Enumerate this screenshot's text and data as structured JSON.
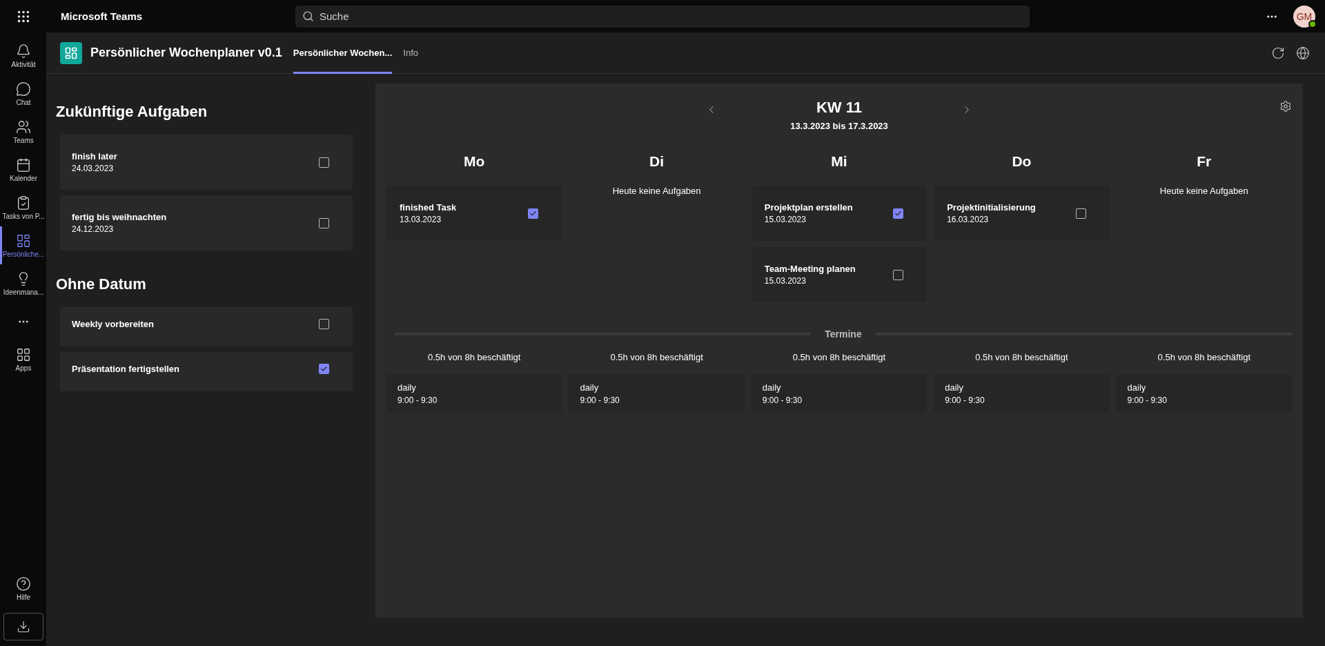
{
  "top_bar": {
    "app_name": "Microsoft Teams",
    "search": {
      "placeholder": "Suche"
    },
    "avatar": {
      "initials": "GM",
      "online": true
    }
  },
  "rail": {
    "items": [
      {
        "kind": "bell",
        "label": "Aktivität",
        "selected": false
      },
      {
        "kind": "chat",
        "label": "Chat",
        "selected": false
      },
      {
        "kind": "teams",
        "label": "Teams",
        "selected": false
      },
      {
        "kind": "calendar",
        "label": "Kalender",
        "selected": false
      },
      {
        "kind": "tasks",
        "label": "Tasks von P...",
        "selected": false
      },
      {
        "kind": "planner",
        "label": "Persönliche...",
        "selected": true
      },
      {
        "kind": "idea",
        "label": "Ideenmana...",
        "selected": false
      },
      {
        "kind": "more"
      },
      {
        "kind": "apps",
        "label": "Apps",
        "selected": false
      }
    ],
    "bottom": [
      {
        "kind": "help",
        "label": "Hilfe",
        "selected": false
      }
    ]
  },
  "app_header": {
    "title": "Persönlicher Wochenplaner v0.1",
    "tabs": [
      {
        "label": "Persönlicher Wochen...",
        "selected": true
      },
      {
        "label": "Info",
        "selected": false
      }
    ]
  },
  "sidebar": {
    "sections": [
      {
        "title": "Zukünftige Aufgaben",
        "tasks": [
          {
            "title": "finish later",
            "date": "24.03.2023",
            "checked": false
          },
          {
            "title": "fertig bis weihnachten",
            "date": "24.12.2023",
            "checked": false
          }
        ]
      },
      {
        "title": "Ohne Datum",
        "tasks": [
          {
            "title": "Weekly vorbereiten",
            "checked": false
          },
          {
            "title": "Präsentation fertigstellen",
            "checked": true
          }
        ]
      }
    ]
  },
  "planner": {
    "week": "KW 11",
    "range": "13.3.2023 bis 17.3.2023",
    "days": [
      {
        "name": "Mo",
        "tasks": [
          {
            "title": "finished Task",
            "date": "13.03.2023",
            "checked": true
          }
        ],
        "busy": "0.5h von 8h beschäftigt",
        "events": [
          {
            "title": "daily",
            "time": "9:00 - 9:30"
          }
        ]
      },
      {
        "name": "Di",
        "empty": "Heute keine Aufgaben",
        "busy": "0.5h von 8h beschäftigt",
        "events": [
          {
            "title": "daily",
            "time": "9:00 - 9:30"
          }
        ]
      },
      {
        "name": "Mi",
        "tasks": [
          {
            "title": "Projektplan erstellen",
            "date": "15.03.2023",
            "checked": true
          },
          {
            "title": "Team-Meeting planen",
            "date": "15.03.2023",
            "checked": false
          }
        ],
        "busy": "0.5h von 8h beschäftigt",
        "events": [
          {
            "title": "daily",
            "time": "9:00 - 9:30"
          }
        ]
      },
      {
        "name": "Do",
        "tasks": [
          {
            "title": "Projektinitialisierung",
            "date": "16.03.2023",
            "checked": false
          }
        ],
        "busy": "0.5h von 8h beschäftigt",
        "events": [
          {
            "title": "daily",
            "time": "9:00 - 9:30"
          }
        ]
      },
      {
        "name": "Fr",
        "empty": "Heute keine Aufgaben",
        "busy": "0.5h von 8h beschäftigt",
        "events": [
          {
            "title": "daily",
            "time": "9:00 - 9:30"
          }
        ]
      }
    ],
    "section_label": "Termine"
  }
}
